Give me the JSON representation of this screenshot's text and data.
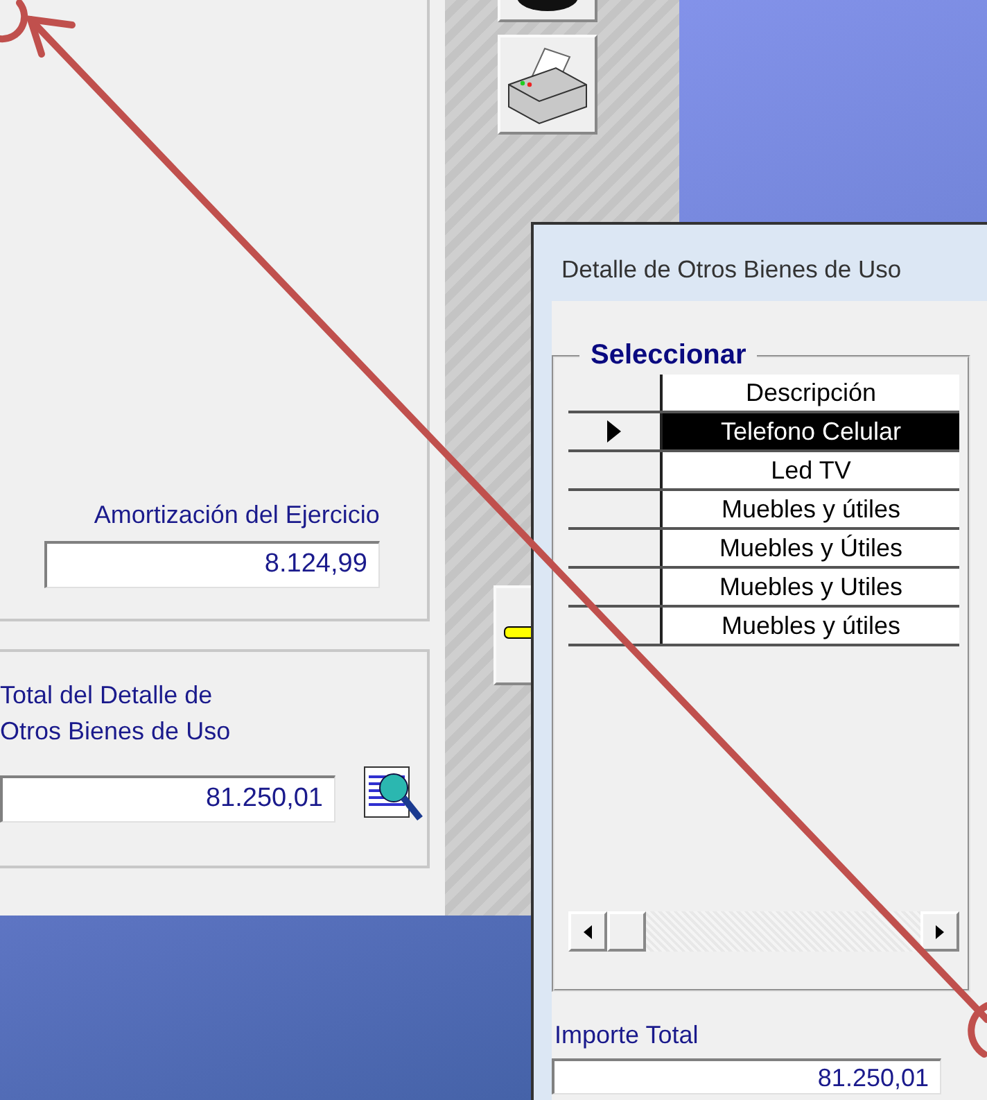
{
  "main_window": {
    "amortization": {
      "label": "Amortización del Ejercicio",
      "value": "8.124,99"
    },
    "total": {
      "label_lines": [
        "Total del Detalle de",
        "Otros Bienes de Uso"
      ],
      "value": "81.250,01"
    }
  },
  "dialog": {
    "title": "Detalle de Otros Bienes de Uso",
    "group_title": "Seleccionar",
    "table": {
      "columns": [
        "Descripción"
      ],
      "rows": [
        {
          "description": "Telefono Celular",
          "selected": true
        },
        {
          "description": "Led TV",
          "selected": false
        },
        {
          "description": "Muebles y útiles",
          "selected": false
        },
        {
          "description": "Muebles y Útiles",
          "selected": false
        },
        {
          "description": "Muebles y Utiles",
          "selected": false
        },
        {
          "description": "Muebles y útiles",
          "selected": false
        }
      ]
    },
    "total": {
      "label": "Importe Total",
      "value": "81.250,01"
    }
  }
}
